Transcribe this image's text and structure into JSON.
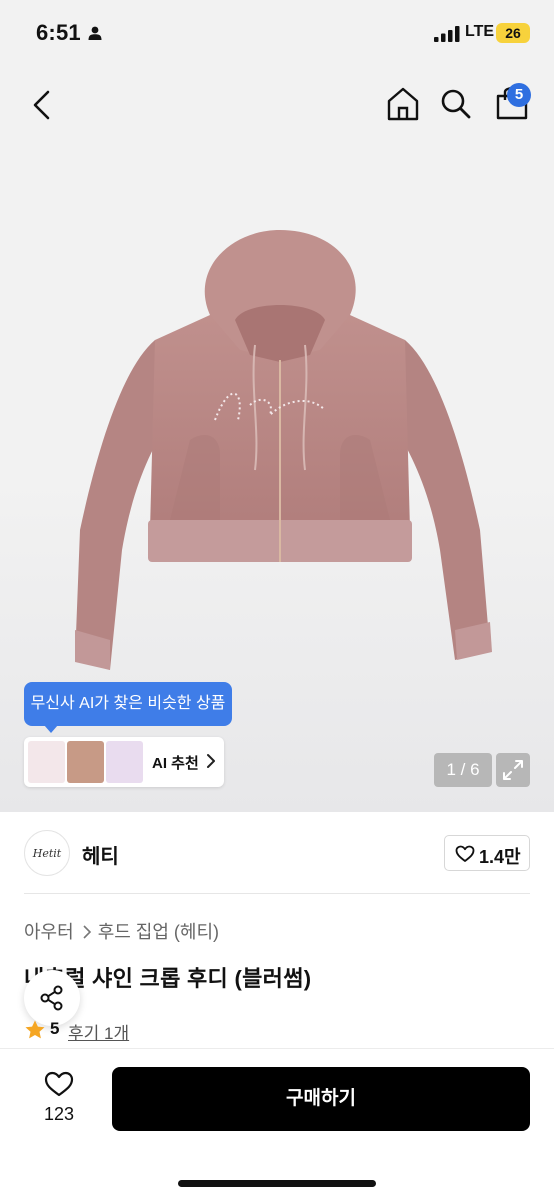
{
  "status_bar": {
    "time": "6:51",
    "network": "LTE",
    "battery": "26"
  },
  "header": {
    "cart_count": "5"
  },
  "gallery": {
    "ai_tip": "무신사 AI가 찾은 비슷한 상품",
    "ai_recommend_label": "AI 추천",
    "page_indicator": "1 / 6"
  },
  "brand": {
    "logo_text": "Hetit",
    "name": "헤티",
    "likes": "1.4만"
  },
  "product": {
    "breadcrumb": [
      "아우터",
      "후드 집업 (헤티)"
    ],
    "title": "내추럴 샤인 크롭 후디 (블러썸)",
    "rating": "5",
    "review_link": "후기 1개"
  },
  "bottom_bar": {
    "wish_count": "123",
    "buy_label": "구매하기"
  },
  "colors": {
    "accent": "#3f7de8",
    "badge": "#2f6fe0",
    "product": "#b98583"
  }
}
